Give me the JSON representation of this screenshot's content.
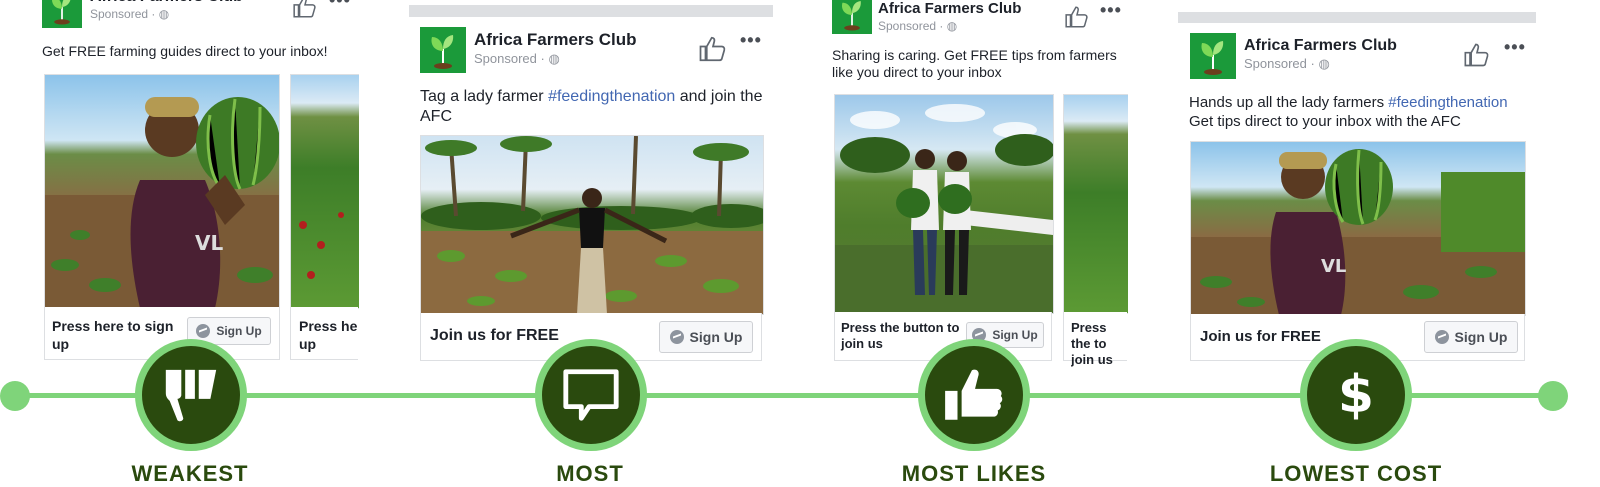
{
  "page_name": "Africa Farmers Club",
  "sponsored": "Sponsored · ",
  "ads": [
    {
      "body": "Get FREE farming guides direct to your inbox!",
      "cards": [
        {
          "cta": "Press here to sign up",
          "button": "Sign Up"
        },
        {
          "cta": "Press he up",
          "button": ""
        }
      ]
    },
    {
      "body_pre": "Tag a lady farmer ",
      "hashtag": "#feedingthenation",
      "body_post": " and join the AFC",
      "cta": "Join us for FREE",
      "button": "Sign Up"
    },
    {
      "body": "Sharing is caring. Get FREE tips from farmers like you direct to your inbox",
      "cards": [
        {
          "cta": "Press the button to join us",
          "button": "Sign Up"
        },
        {
          "cta": "Press the to join us",
          "button": ""
        }
      ]
    },
    {
      "body_pre": "Hands up all the lady farmers ",
      "hashtag": "#feedingthenation",
      "body_post": "Get tips direct to your inbox with the AFC",
      "cta": "Join us for FREE",
      "button": "Sign Up"
    }
  ],
  "timeline": {
    "badges": [
      {
        "icon": "thumbs-down-icon",
        "label": "WEAKEST"
      },
      {
        "icon": "speech-bubble-icon",
        "label": "MOST"
      },
      {
        "icon": "thumbs-up-icon",
        "label": "MOST LIKES"
      },
      {
        "icon": "dollar-icon",
        "label": "LOWEST COST"
      }
    ]
  },
  "colors": {
    "timeline_green": "#7fd47a",
    "badge_dark_green": "#2a4a0e",
    "hashtag_blue": "#4267b2"
  }
}
